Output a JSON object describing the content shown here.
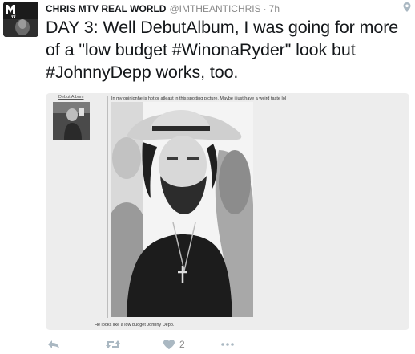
{
  "tweet": {
    "display_name": "CHRIS MTV REAL WORLD",
    "handle": "@IMTHEANTICHRIS",
    "separator": "·",
    "time": "7h",
    "text": "DAY 3: Well DebutAlbum, I was going for more of a \"low budget #WinonaRyder\" look but #JohnnyDepp works, too."
  },
  "media": {
    "username": "Debut Album",
    "caption_top": "In my opinionhe is hot or atleast in this spotting picture. Maybe i just have a weird taste lol",
    "caption_bottom": "He looks like a low budget Johnny Depp."
  },
  "actions": {
    "like_count": "2"
  },
  "icons": {
    "reply": "reply-icon",
    "retweet": "retweet-icon",
    "like": "heart-icon",
    "more": "more-icon",
    "location": "location-pin-icon",
    "avatar_logo": "mtv-logo"
  },
  "colors": {
    "action_icon": "#aab8c2",
    "muted_text": "#8a8a8a",
    "text": "#14171a"
  }
}
